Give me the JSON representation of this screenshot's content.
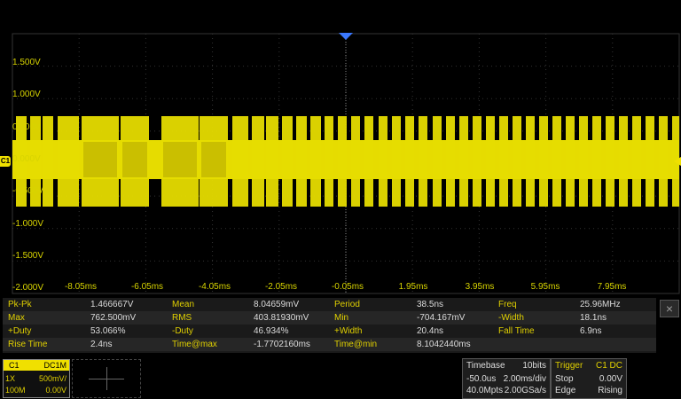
{
  "channel": {
    "marker": "C1",
    "color": "#f0e000"
  },
  "colors": {
    "trace": "#e6dc00",
    "grid": "#333333",
    "label": "#d8d400",
    "trigger": "#3a78ff"
  },
  "y_labels": [
    "1.500V",
    "1.000V",
    "0.500V",
    "0.000V",
    "-0.500V",
    "-1.000V",
    "-1.500V",
    "-2.000V"
  ],
  "x_labels": [
    "-8.05ms",
    "-6.05ms",
    "-4.05ms",
    "-2.05ms",
    "-0.05ms",
    "1.95ms",
    "3.95ms",
    "5.95ms",
    "7.95ms"
  ],
  "measurements": [
    [
      {
        "label": "Pk-Pk",
        "value": "1.466667V"
      },
      {
        "label": "Mean",
        "value": "8.04659mV"
      },
      {
        "label": "Period",
        "value": "38.5ns"
      },
      {
        "label": "Freq",
        "value": "25.96MHz"
      }
    ],
    [
      {
        "label": "Max",
        "value": "762.500mV"
      },
      {
        "label": "RMS",
        "value": "403.81930mV"
      },
      {
        "label": "Min",
        "value": "-704.167mV"
      },
      {
        "label": "-Width",
        "value": "18.1ns"
      }
    ],
    [
      {
        "label": "+Duty",
        "value": "53.066%"
      },
      {
        "label": "-Duty",
        "value": "46.934%"
      },
      {
        "label": "+Width",
        "value": "20.4ns"
      },
      {
        "label": "Fall Time",
        "value": "6.9ns"
      }
    ],
    [
      {
        "label": "Rise Time",
        "value": "2.4ns"
      },
      {
        "label": "Time@max",
        "value": "-1.7702160ms"
      },
      {
        "label": "Time@min",
        "value": "8.1042440ms"
      }
    ]
  ],
  "close_icon": "×",
  "ch1": {
    "name": "C1",
    "coupling": "DC1M",
    "probe": "1X",
    "scale": "500mV/",
    "bw": "100M",
    "offset": "0.00V"
  },
  "timebase": {
    "title": "Timebase",
    "bits": "10bits",
    "delay": "-50.0us",
    "scale": "2.00ms/div",
    "mem": "40.0Mpts",
    "rate": "2.00GSa/s"
  },
  "trigger": {
    "title": "Trigger",
    "source": "C1 DC",
    "state": "Stop",
    "level": "0.00V",
    "type": "Edge",
    "slope": "Rising"
  }
}
